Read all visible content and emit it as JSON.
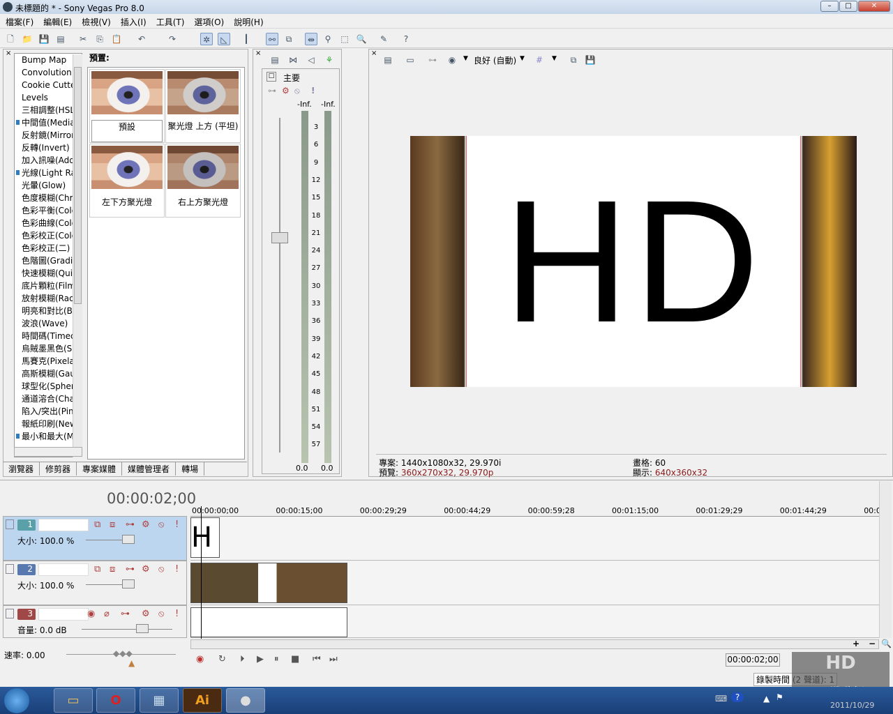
{
  "window": {
    "title": "未標題的 * - Sony Vegas Pro 8.0"
  },
  "menu": [
    "檔案(F)",
    "編輯(E)",
    "檢視(V)",
    "插入(I)",
    "工具(T)",
    "選項(O)",
    "說明(H)"
  ],
  "effects": {
    "items": [
      {
        "label": "Bump Map",
        "mark": false
      },
      {
        "label": "Convolution",
        "mark": false
      },
      {
        "label": "Cookie Cutter",
        "mark": false
      },
      {
        "label": "Levels",
        "mark": false
      },
      {
        "label": "三相調整(HSL)",
        "mark": false
      },
      {
        "label": "中間值(Median)",
        "mark": true
      },
      {
        "label": "反射鏡(Mirror)",
        "mark": false
      },
      {
        "label": "反轉(Invert)",
        "mark": false
      },
      {
        "label": "加入訊噪(Add Noise)",
        "mark": false
      },
      {
        "label": "光線(Light Rays)",
        "mark": true
      },
      {
        "label": "光暈(Glow)",
        "mark": false
      },
      {
        "label": "色度模糊(Chroma Blur)",
        "mark": false
      },
      {
        "label": "色彩平衡(Color Balance)",
        "mark": false
      },
      {
        "label": "色彩曲線(Color Curves)",
        "mark": false
      },
      {
        "label": "色彩校正(Color Corrector)",
        "mark": false
      },
      {
        "label": "色彩校正(二)",
        "mark": false
      },
      {
        "label": "色階圖(Gradient Map)",
        "mark": false
      },
      {
        "label": "快速模糊(Quick Blur)",
        "mark": false
      },
      {
        "label": "底片顆粒(Film Grain)",
        "mark": false
      },
      {
        "label": "放射模糊(Radial Blur)",
        "mark": false
      },
      {
        "label": "明亮和對比(Brightness)",
        "mark": false
      },
      {
        "label": "波浪(Wave)",
        "mark": false
      },
      {
        "label": "時間碼(Timecode)",
        "mark": false
      },
      {
        "label": "烏賊墨黑色(Sepia)",
        "mark": false
      },
      {
        "label": "馬賽克(Pixelate)",
        "mark": false
      },
      {
        "label": "高斯模糊(Gaussian Blur)",
        "mark": false
      },
      {
        "label": "球型化(Spherize)",
        "mark": false
      },
      {
        "label": "通道溶合(Channel Blend)",
        "mark": false
      },
      {
        "label": "陷入/突出(Pinch/Punch)",
        "mark": false
      },
      {
        "label": "報紙印刷(Newsprint)",
        "mark": false
      },
      {
        "label": "最小和最大(Min and Max)",
        "mark": true
      }
    ]
  },
  "presets": {
    "title": "預置:",
    "items": [
      "預設",
      "聚光燈 上方 (平坦)",
      "左下方聚光燈",
      "右上方聚光燈"
    ]
  },
  "tabs": [
    "瀏覽器",
    "修剪器",
    "專案媒體",
    "媒體管理者",
    "轉場"
  ],
  "mixer": {
    "label": "主要",
    "inf_left": "-Inf.",
    "inf_right": "-Inf.",
    "ticks": [
      "3",
      "6",
      "9",
      "12",
      "15",
      "18",
      "21",
      "24",
      "27",
      "30",
      "33",
      "36",
      "39",
      "42",
      "45",
      "48",
      "51",
      "54",
      "57"
    ],
    "val_left": "0.0",
    "val_right": "0.0"
  },
  "preview": {
    "quality": "良好 (自動)",
    "frame_text": "HD",
    "project_label": "專案:",
    "project_value": "1440x1080x32, 29.970i",
    "preview_label": "預覽:",
    "preview_value": "360x270x32, 29.970p",
    "frame_label": "畫格:",
    "frame_value": "60",
    "display_label": "顯示:",
    "display_value": "640x360x32"
  },
  "timeline": {
    "timecode": "00:00:02;00",
    "ruler": [
      "00:00:00;00",
      "00:00:15;00",
      "00:00:29;29",
      "00:00:44;29",
      "00:00:59;28",
      "00:01:15;00",
      "00:01:29;29",
      "00:01:44;29",
      "00:0"
    ],
    "tracks": [
      {
        "num": "1",
        "label": "大小:",
        "value": "100.0 %",
        "color": "#5aa0a8"
      },
      {
        "num": "2",
        "label": "大小:",
        "value": "100.0 %",
        "color": "#5878b0"
      },
      {
        "num": "3",
        "label": "音量:",
        "value": "0.0 dB",
        "color": "#a04848"
      }
    ],
    "rate_label": "速率:",
    "rate_value": "0.00",
    "cursor_time": "00:00:02;00",
    "record_time": "錄製時間 (2 聲道): 1"
  },
  "taskbar": {
    "date": "2011/10/29",
    "apps": [
      "folder",
      "opera",
      "control-panel",
      "illustrator",
      "vegas"
    ],
    "app_labels": {
      "illustrator": "Ai"
    }
  },
  "watermark": {
    "text": "HD CLUB www.HD-Club.tw"
  }
}
